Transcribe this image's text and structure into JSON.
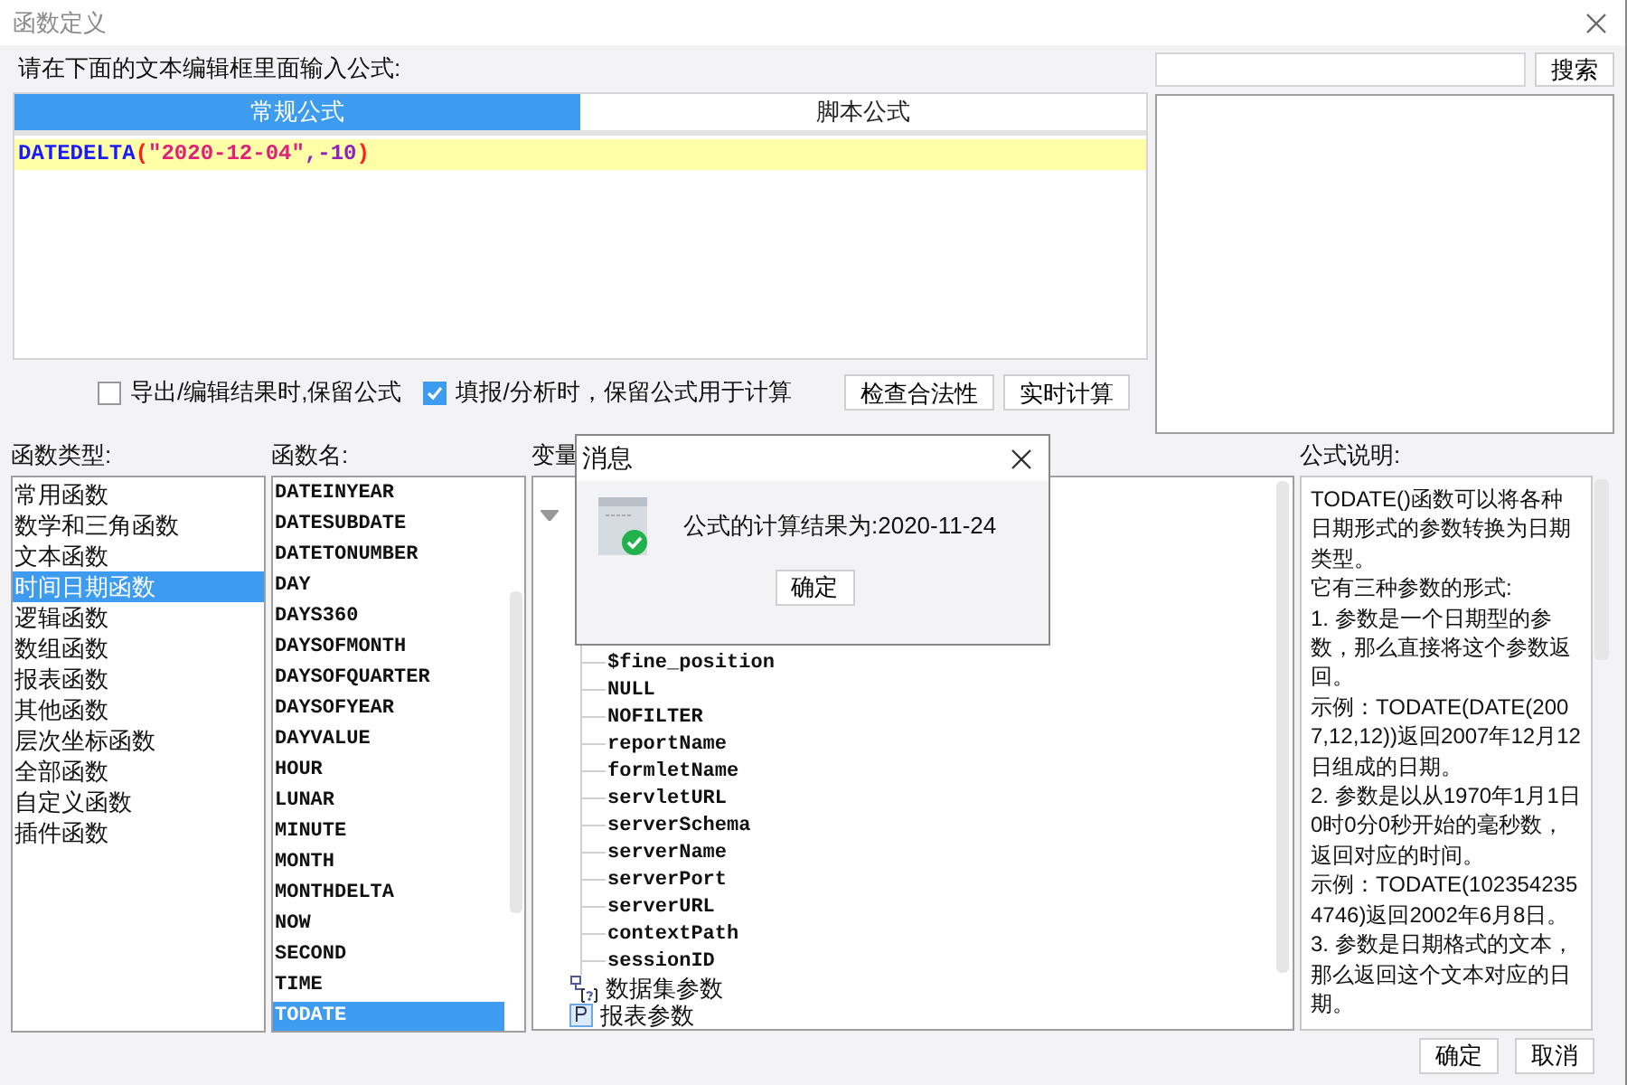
{
  "window": {
    "title": "函数定义"
  },
  "editor": {
    "label": "请在下面的文本编辑框里面输入公式:",
    "tabs": [
      {
        "label": "常规公式",
        "selected": true
      },
      {
        "label": "脚本公式",
        "selected": false
      }
    ],
    "formula": [
      {
        "kind": "function",
        "text": "DATEDELTA"
      },
      {
        "kind": "paren",
        "text": "("
      },
      {
        "kind": "string",
        "text": "\"2020-12-04\""
      },
      {
        "kind": "operator",
        "text": ","
      },
      {
        "kind": "number",
        "text": "-10"
      },
      {
        "kind": "paren",
        "text": ")"
      }
    ]
  },
  "options": [
    {
      "label": "导出/编辑结果时,保留公式",
      "checked": false
    },
    {
      "label": "填报/分析时，保留公式用于计算",
      "checked": true
    }
  ],
  "actions": [
    "检查合法性",
    "实时计算"
  ],
  "search": {
    "button": "搜索"
  },
  "categories": {
    "label": "函数类型:",
    "items": [
      {
        "label": "常用函数",
        "selected": false
      },
      {
        "label": "数学和三角函数",
        "selected": false
      },
      {
        "label": "文本函数",
        "selected": false
      },
      {
        "label": "时间日期函数",
        "selected": true
      },
      {
        "label": "逻辑函数",
        "selected": false
      },
      {
        "label": "数组函数",
        "selected": false
      },
      {
        "label": "报表函数",
        "selected": false
      },
      {
        "label": "其他函数",
        "selected": false
      },
      {
        "label": "层次坐标函数",
        "selected": false
      },
      {
        "label": "全部函数",
        "selected": false
      },
      {
        "label": "自定义函数",
        "selected": false
      },
      {
        "label": "插件函数",
        "selected": false
      }
    ]
  },
  "functions": {
    "label": "函数名:",
    "items": [
      {
        "label": "DATEINYEAR",
        "selected": false
      },
      {
        "label": "DATESUBDATE",
        "selected": false
      },
      {
        "label": "DATETONUMBER",
        "selected": false
      },
      {
        "label": "DAY",
        "selected": false
      },
      {
        "label": "DAYS360",
        "selected": false
      },
      {
        "label": "DAYSOFMONTH",
        "selected": false
      },
      {
        "label": "DAYSOFQUARTER",
        "selected": false
      },
      {
        "label": "DAYSOFYEAR",
        "selected": false
      },
      {
        "label": "DAYVALUE",
        "selected": false
      },
      {
        "label": "HOUR",
        "selected": false
      },
      {
        "label": "LUNAR",
        "selected": false
      },
      {
        "label": "MINUTE",
        "selected": false
      },
      {
        "label": "MONTH",
        "selected": false
      },
      {
        "label": "MONTHDELTA",
        "selected": false
      },
      {
        "label": "NOW",
        "selected": false
      },
      {
        "label": "SECOND",
        "selected": false
      },
      {
        "label": "TIME",
        "selected": false
      },
      {
        "label": "TODATE",
        "selected": true
      }
    ]
  },
  "variables": {
    "label": "变量",
    "tree": [
      {
        "expanded": true,
        "children": [
          {
            "label": "$fine_position"
          },
          {
            "label": "NULL"
          },
          {
            "label": "NOFILTER"
          },
          {
            "label": "reportName"
          },
          {
            "label": "formletName"
          },
          {
            "label": "servletURL"
          },
          {
            "label": "serverSchema"
          },
          {
            "label": "serverName"
          },
          {
            "label": "serverPort"
          },
          {
            "label": "serverURL"
          },
          {
            "label": "contextPath"
          },
          {
            "label": "sessionID"
          }
        ]
      },
      {
        "label": "数据集参数",
        "kind": "dataset"
      },
      {
        "label": "报表参数",
        "kind": "parameter"
      }
    ]
  },
  "description": {
    "label": "公式说明:",
    "paragraphs": [
      "TODATE()函数可以将各种日期形式的参数转换为日期类型。",
      "它有三种参数的形式:",
      "1. 参数是一个日期型的参数，那么直接将这个参数返回。",
      "示例：TODATE(DATE(2007,12,12))返回2007年12月12日组成的日期。",
      "2. 参数是以从1970年1月1日0时0分0秒开始的毫秒数，返回对应的时间。",
      "示例：TODATE(1023542354746)返回2002年6月8日。",
      "3. 参数是日期格式的文本，那么返回这个文本对应的日期。"
    ]
  },
  "footer": [
    "确定",
    "取消"
  ],
  "message": {
    "title": "消息",
    "text": "公式的计算结果为:2020-11-24",
    "button": "确定"
  }
}
